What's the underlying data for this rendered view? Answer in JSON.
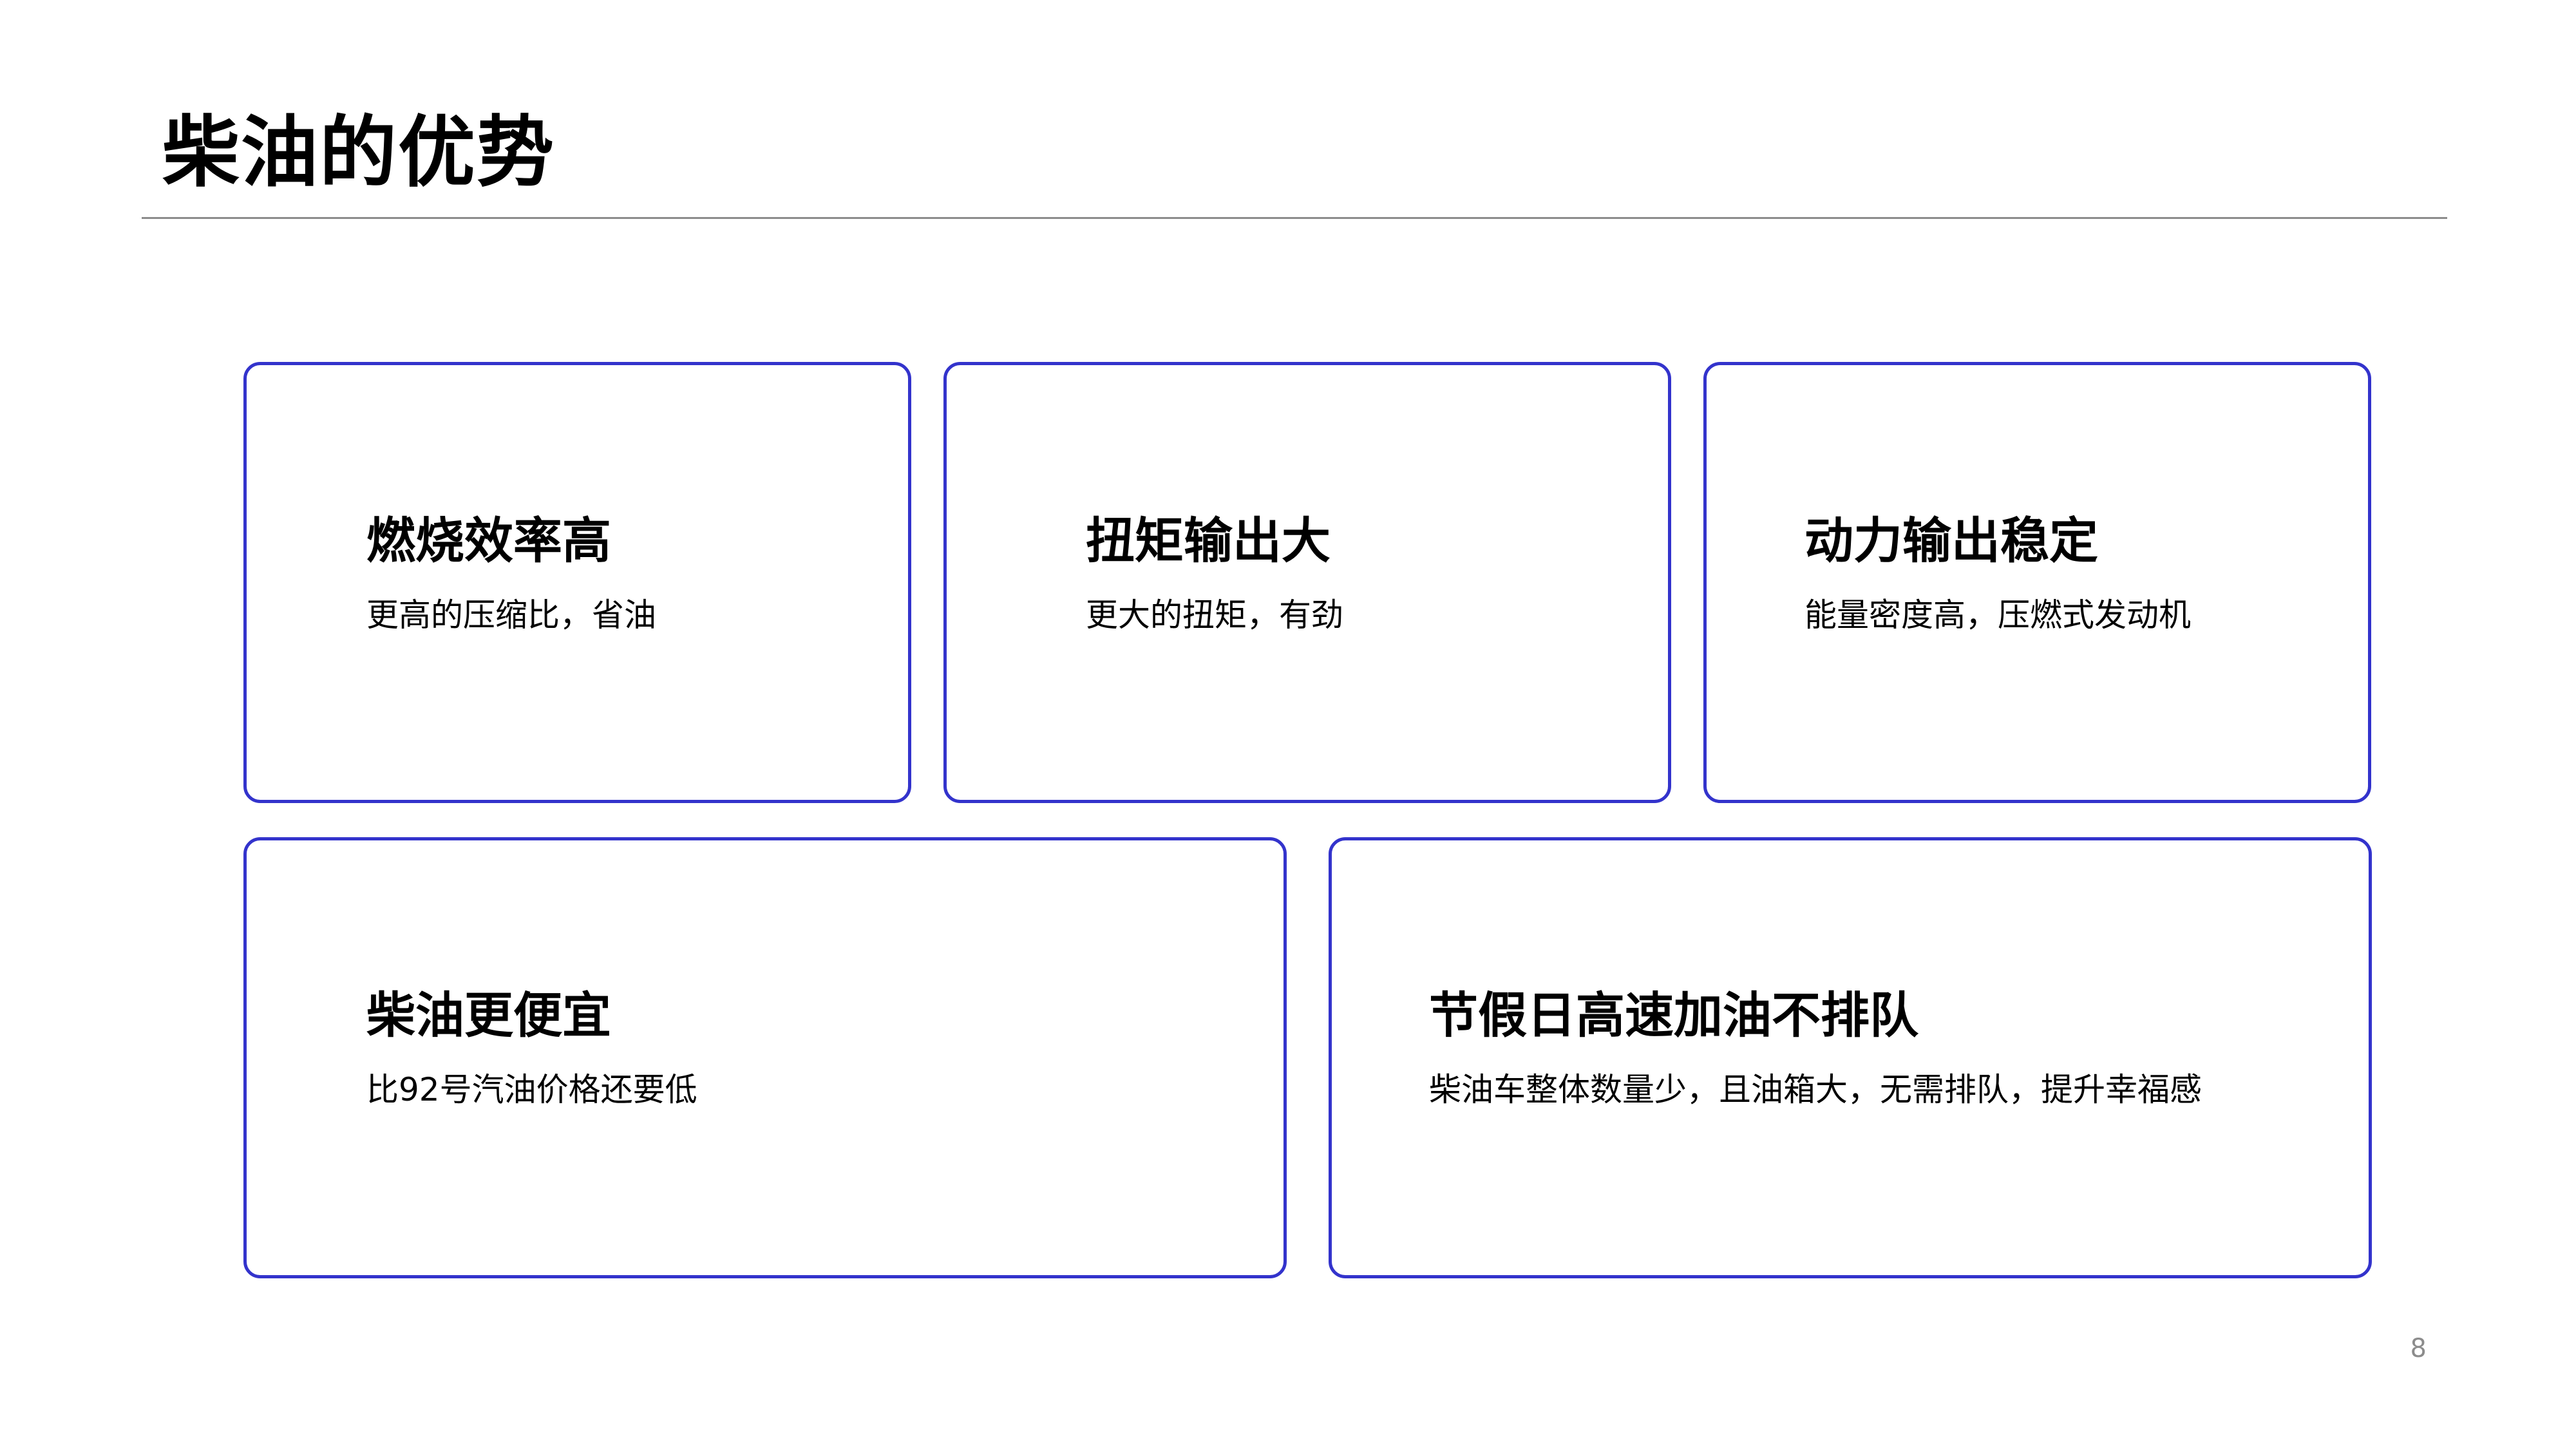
{
  "slide": {
    "title": "柴油的优势",
    "page_number": "8"
  },
  "cards": [
    {
      "heading": "燃烧效率高",
      "text": "更高的压缩比，省油"
    },
    {
      "heading": "扭矩输出大",
      "text": "更大的扭矩，有劲"
    },
    {
      "heading": "动力输出稳定",
      "text": "能量密度高，压燃式发动机"
    },
    {
      "heading": "柴油更便宜",
      "text": "比92号汽油价格还要低"
    },
    {
      "heading": "节假日高速加油不排队",
      "text": "柴油车整体数量少，且油箱大，无需排队，提升幸福感"
    }
  ],
  "colors": {
    "card_border": "#3333cc",
    "rule": "#8c8c8c",
    "text": "#000000"
  }
}
